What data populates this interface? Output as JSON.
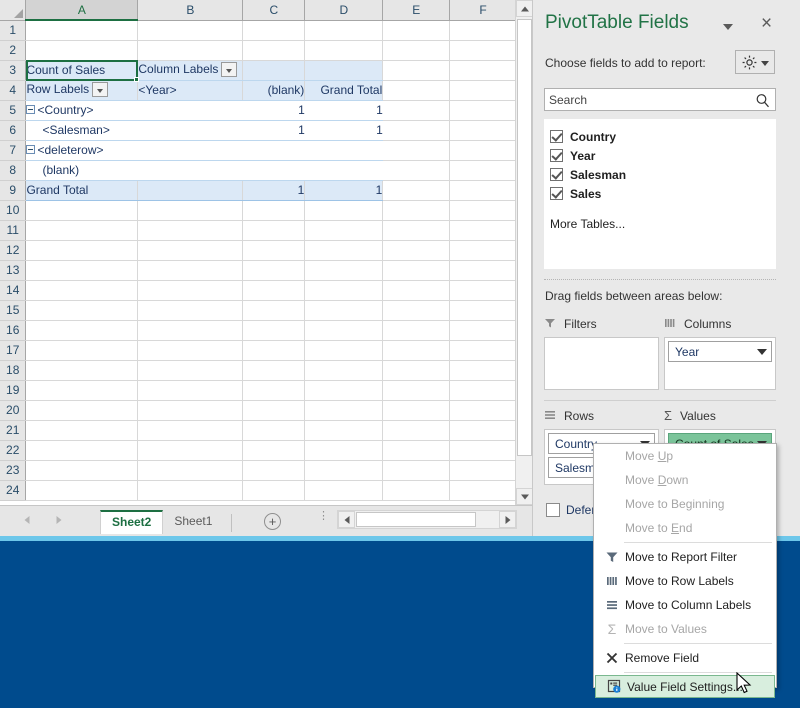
{
  "grid": {
    "columns": [
      "A",
      "B",
      "C",
      "D",
      "E",
      "F"
    ],
    "selected_column": "A",
    "selected_cell": "A3",
    "rows": [
      1,
      2,
      3,
      4,
      5,
      6,
      7,
      8,
      9,
      10,
      11,
      12,
      13,
      14,
      15,
      16,
      17,
      18,
      19,
      20,
      21,
      22,
      23,
      24
    ],
    "pivot": {
      "value_header": "Count of Sales",
      "column_labels": "Column Labels",
      "row_labels": "Row Labels",
      "year_header": "<Year>",
      "blank_header": "(blank)",
      "grand_total_header": "Grand Total",
      "body_rows": [
        {
          "row": 5,
          "label": "<Country>",
          "indent": 0,
          "collapse": true,
          "bold": true,
          "c": "1",
          "d": "1"
        },
        {
          "row": 6,
          "label": "<Salesman>",
          "indent": 1,
          "collapse": false,
          "bold": false,
          "c": "1",
          "d": "1"
        },
        {
          "row": 7,
          "label": "<deleterow>",
          "indent": 0,
          "collapse": true,
          "bold": true,
          "c": "",
          "d": ""
        },
        {
          "row": 8,
          "label": "(blank)",
          "indent": 1,
          "collapse": false,
          "bold": false,
          "c": "",
          "d": ""
        }
      ],
      "grand_total_row": {
        "row": 9,
        "label": "Grand Total",
        "c": "1",
        "d": "1"
      }
    }
  },
  "tabs": {
    "sheets": [
      {
        "name": "Sheet2",
        "active": true
      },
      {
        "name": "Sheet1",
        "active": false
      }
    ],
    "add_sheet_label": "+"
  },
  "panel": {
    "title": "PivotTable Fields",
    "close_label": "×",
    "choose_label": "Choose fields to add to report:",
    "search": {
      "placeholder": "Search",
      "value": ""
    },
    "fields": [
      {
        "label": "Country",
        "checked": true
      },
      {
        "label": "Year",
        "checked": true
      },
      {
        "label": "Salesman",
        "checked": true
      },
      {
        "label": "Sales",
        "checked": true
      }
    ],
    "more_tables": "More Tables...",
    "drag_label": "Drag fields between areas below:",
    "areas": {
      "filters": {
        "title": "Filters",
        "items": []
      },
      "columns": {
        "title": "Columns",
        "items": [
          "Year"
        ]
      },
      "rows": {
        "title": "Rows",
        "items": [
          "Country",
          "Salesman"
        ]
      },
      "values": {
        "title": "Values",
        "items": [
          "Count of Sales"
        ],
        "highlight_color": "#7bc49a"
      }
    },
    "defer_label": "Defer Layout Update"
  },
  "context_menu": {
    "items": [
      {
        "label": "Move Up",
        "icon": "",
        "disabled": true,
        "accel": "U"
      },
      {
        "label": "Move Down",
        "icon": "",
        "disabled": true,
        "accel": "D"
      },
      {
        "label": "Move to Beginning",
        "icon": "",
        "disabled": true,
        "accel": "g"
      },
      {
        "label": "Move to End",
        "icon": "",
        "disabled": true,
        "accel": "E"
      },
      {
        "label": "Move to Report Filter",
        "icon": "funnel-icon",
        "disabled": false
      },
      {
        "label": "Move to Row Labels",
        "icon": "bars-icon",
        "disabled": false
      },
      {
        "label": "Move to Column Labels",
        "icon": "lines-icon",
        "disabled": false
      },
      {
        "label": "Move to Values",
        "icon": "sigma-icon",
        "disabled": true
      },
      {
        "label": "Remove Field",
        "icon": "x-icon",
        "disabled": false
      },
      {
        "label": "Value Field Settings...",
        "icon": "settings-info-icon",
        "disabled": false,
        "highlighted": true
      }
    ]
  },
  "colors": {
    "excel_green": "#217346",
    "pivot_header_blue": "#dce9f7",
    "desktop_blue": "#004B8D",
    "accent_strip": "#6dc7ea",
    "values_pill_green": "#7bc49a"
  }
}
